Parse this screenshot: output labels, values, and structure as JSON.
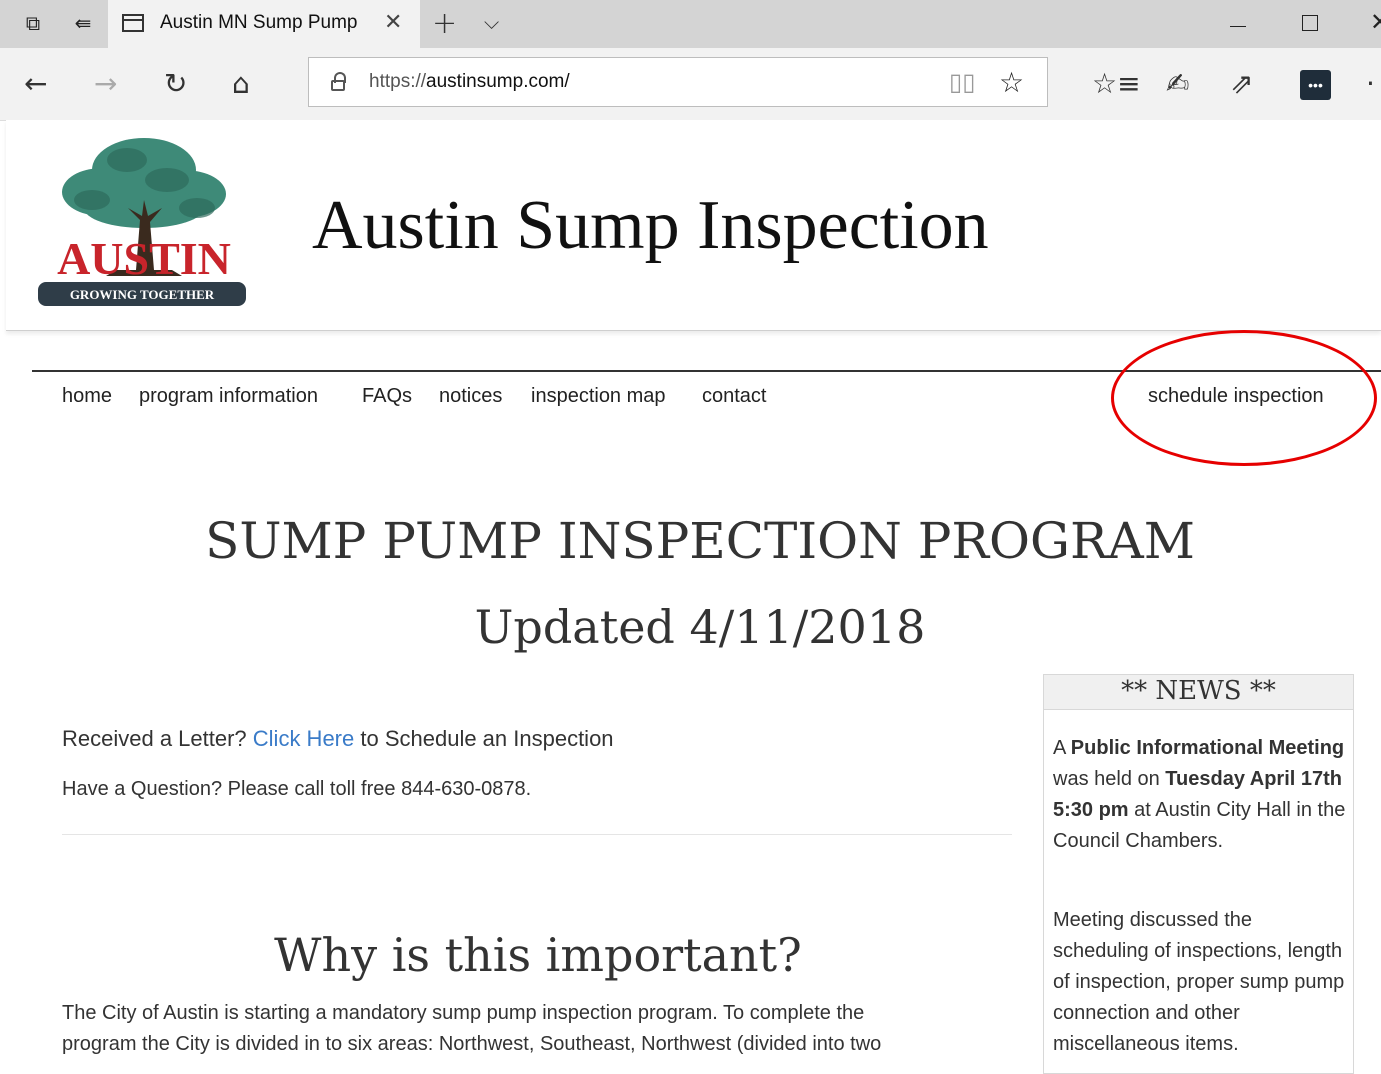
{
  "browser": {
    "tab_title": "Austin MN Sump Pump",
    "url_scheme": "https://",
    "url_host": "austinsump.com/",
    "icons": [
      "tab-manager-icon",
      "set-aside-tabs-icon",
      "page-icon",
      "close-icon",
      "plus-icon",
      "chevron-down-icon",
      "minimize-icon",
      "maximize-icon",
      "back-icon",
      "forward-icon",
      "refresh-icon",
      "home-icon",
      "lock-icon",
      "reading-view-icon",
      "star-icon",
      "favorites-icon",
      "pen-icon",
      "share-icon",
      "extension-icon",
      "more-icon"
    ]
  },
  "header": {
    "logo_text": "AUSTIN",
    "logo_tagline": "GROWING TOGETHER",
    "title": "Austin Sump Inspection"
  },
  "nav": {
    "items": [
      "home",
      "program information",
      "FAQs",
      "notices",
      "inspection map",
      "contact"
    ],
    "schedule": "schedule inspection"
  },
  "main": {
    "heading": "SUMP PUMP INSPECTION PROGRAM",
    "subheading": "Updated 4/11/2018",
    "letter_pre": "Received a Letter? ",
    "letter_link": "Click Here",
    "letter_post": " to Schedule an Inspection",
    "question": "Have a Question? Please call toll free 844-630-0878.",
    "why_heading": "Why is this important?",
    "why_line1": "The City of Austin is starting a mandatory sump pump inspection program.  To complete the",
    "why_line2": "program the City is divided in to six areas: Northwest, Southeast, Northwest (divided into two"
  },
  "news": {
    "title": "** NEWS **",
    "p1_a": "A ",
    "p1_b": "Public Informational Meeting",
    "p1_c": " was held on ",
    "p1_d": "Tuesday April 17th 5:30 pm",
    "p1_e": " at Austin City Hall in the Council Chambers.",
    "p2": "Meeting discussed the scheduling of inspections, length of inspection, proper sump pump connection and other miscellaneous items."
  },
  "colors": {
    "link": "#3a7bc8",
    "annotation_circle": "#e60000",
    "logo_red": "#c8242b"
  }
}
